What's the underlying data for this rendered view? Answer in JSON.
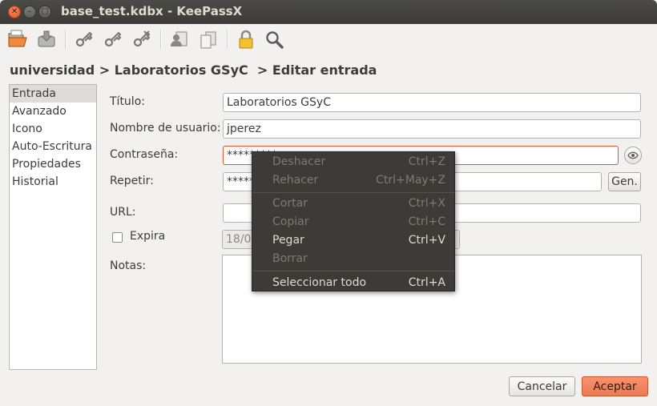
{
  "window": {
    "title": "base_test.kdbx - KeePassX",
    "close_glyph": "✕",
    "minimize_glyph": "–",
    "maximize_glyph": "□"
  },
  "toolbar": {
    "items": [
      {
        "icon": "open-database-icon"
      },
      {
        "icon": "save-database-icon"
      },
      {
        "icon": "add-entry-icon"
      },
      {
        "icon": "edit-entry-icon"
      },
      {
        "icon": "delete-entry-icon"
      },
      {
        "icon": "copy-username-icon"
      },
      {
        "icon": "copy-password-icon"
      },
      {
        "icon": "lock-database-icon"
      },
      {
        "icon": "search-icon"
      }
    ]
  },
  "breadcrumb": {
    "text": "universidad > Laboratorios GSyC  > Editar entrada"
  },
  "sidebar": {
    "items": [
      {
        "label": "Entrada",
        "active": true
      },
      {
        "label": "Avanzado"
      },
      {
        "label": "Icono"
      },
      {
        "label": "Auto-Escritura"
      },
      {
        "label": "Propiedades"
      },
      {
        "label": "Historial"
      }
    ]
  },
  "form": {
    "title_label": "Título:",
    "title_value": "Laboratorios GSyC",
    "username_label": "Nombre de usuario:",
    "username_value": "jperez",
    "password_label": "Contraseña:",
    "password_value": "*********",
    "repeat_label": "Repetir:",
    "repeat_value": "*********",
    "gen_button": "Gen.",
    "url_label": "URL:",
    "url_value": "",
    "expires_label": "Expira",
    "expires_checked": false,
    "expires_value": "18/0",
    "notes_label": "Notas:",
    "notes_value": ""
  },
  "buttons": {
    "cancel": "Cancelar",
    "accept": "Aceptar"
  },
  "context_menu": {
    "items": [
      {
        "label": "Deshacer",
        "shortcut": "Ctrl+Z",
        "enabled": false
      },
      {
        "label": "Rehacer",
        "shortcut": "Ctrl+May+Z",
        "enabled": false
      },
      {
        "label": "Cortar",
        "shortcut": "Ctrl+X",
        "enabled": false
      },
      {
        "label": "Copiar",
        "shortcut": "Ctrl+C",
        "enabled": false
      },
      {
        "label": "Pegar",
        "shortcut": "Ctrl+V",
        "enabled": true
      },
      {
        "label": "Borrar",
        "shortcut": "",
        "enabled": false
      },
      {
        "label": "Seleccionar todo",
        "shortcut": "Ctrl+A",
        "enabled": true
      }
    ]
  },
  "colors": {
    "accent": "#e5572a",
    "titlebar": "#3c3b37",
    "menu_bg": "#3c3b37",
    "window_bg": "#f2f1f0"
  }
}
